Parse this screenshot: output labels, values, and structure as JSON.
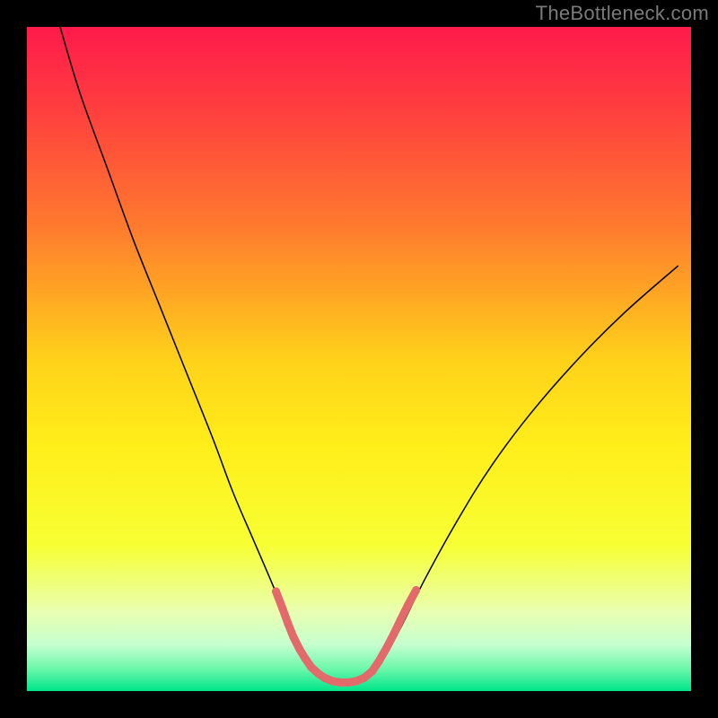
{
  "watermark": "TheBottleneck.com",
  "chart_data": {
    "type": "line",
    "title": "",
    "xlabel": "",
    "ylabel": "",
    "xlim": [
      0,
      100
    ],
    "ylim": [
      0,
      100
    ],
    "grid": false,
    "legend": false,
    "background_gradient": {
      "direction": "vertical",
      "stops": [
        {
          "offset": 0.0,
          "color": "#ff1a4b"
        },
        {
          "offset": 0.12,
          "color": "#ff3d3f"
        },
        {
          "offset": 0.3,
          "color": "#ff7a2e"
        },
        {
          "offset": 0.5,
          "color": "#ffd11a"
        },
        {
          "offset": 0.63,
          "color": "#ffee1a"
        },
        {
          "offset": 0.78,
          "color": "#f7ff33"
        },
        {
          "offset": 0.88,
          "color": "#e9ffb0"
        },
        {
          "offset": 0.93,
          "color": "#c6ffd0"
        },
        {
          "offset": 0.965,
          "color": "#70f8ac"
        },
        {
          "offset": 1.0,
          "color": "#00e58a"
        }
      ]
    },
    "series": [
      {
        "name": "bottleneck-curve",
        "stroke": "#000000",
        "stroke_width": 1.5,
        "x": [
          5,
          8,
          12,
          16,
          20,
          24,
          28,
          31,
          34,
          37,
          39,
          41,
          43,
          45,
          47,
          49,
          51,
          53,
          56,
          60,
          65,
          70,
          76,
          83,
          90,
          98
        ],
        "y": [
          100,
          90,
          79,
          68,
          58,
          48,
          38,
          30,
          23,
          16,
          11,
          7,
          4,
          2.2,
          1.4,
          1.3,
          2.0,
          4,
          9,
          17,
          26,
          34,
          42,
          50,
          57,
          64
        ]
      }
    ],
    "overlay_segments": [
      {
        "name": "coral-left",
        "stroke": "#e36a6a",
        "stroke_width": 9,
        "linecap": "round",
        "x": [
          37.5,
          38.5,
          39.3,
          40.1,
          41.0,
          41.9,
          42.8,
          43.8,
          44.8
        ],
        "y": [
          15.0,
          12.4,
          10.2,
          8.2,
          6.4,
          4.9,
          3.6,
          2.7,
          2.0
        ]
      },
      {
        "name": "coral-bottom",
        "stroke": "#e36a6a",
        "stroke_width": 9,
        "linecap": "round",
        "x": [
          44.8,
          46.0,
          47.2,
          48.4,
          49.6,
          50.8,
          52.0
        ],
        "y": [
          2.0,
          1.5,
          1.3,
          1.3,
          1.5,
          2.0,
          3.0
        ]
      },
      {
        "name": "coral-right",
        "stroke": "#e36a6a",
        "stroke_width": 9,
        "linecap": "round",
        "x": [
          52.0,
          53.0,
          54.1,
          55.2,
          56.3,
          57.4,
          58.6
        ],
        "y": [
          3.0,
          4.5,
          6.4,
          8.5,
          10.8,
          13.0,
          15.2
        ]
      }
    ]
  }
}
